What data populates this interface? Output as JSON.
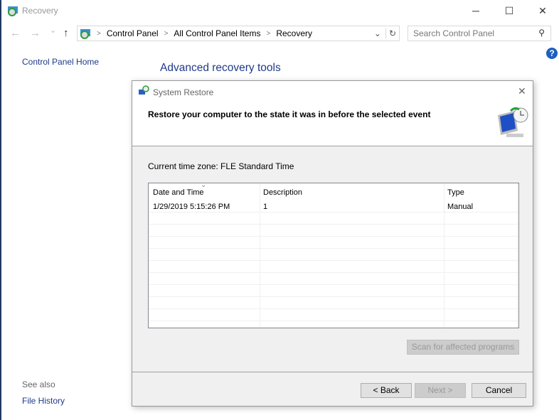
{
  "window": {
    "title": "Recovery",
    "minimize": "─",
    "maximize": "☐",
    "close": "✕"
  },
  "nav": {
    "back": "←",
    "forward": "→",
    "recent": "⌄",
    "up": "↑"
  },
  "address": {
    "crumbs": [
      "Control Panel",
      "All Control Panel Items",
      "Recovery"
    ],
    "dropdown": "⌄",
    "refresh": "↻"
  },
  "search": {
    "placeholder": "Search Control Panel",
    "icon": "⚲"
  },
  "help": "?",
  "sidebar": {
    "home": "Control Panel Home",
    "see_also": "See also",
    "file_history": "File History"
  },
  "main": {
    "heading": "Advanced recovery tools"
  },
  "dialog": {
    "title": "System Restore",
    "close": "✕",
    "instruction": "Restore your computer to the state it was in before the selected event",
    "timezone": "Current time zone: FLE Standard Time",
    "columns": [
      "Date and Time",
      "Description",
      "Type"
    ],
    "sort_indicator": "⌄",
    "rows": [
      {
        "date": "1/29/2019 5:15:26 PM",
        "description": "1",
        "type": "Manual"
      }
    ],
    "scan": "Scan for affected programs",
    "back": "< Back",
    "next": "Next >",
    "cancel": "Cancel"
  }
}
